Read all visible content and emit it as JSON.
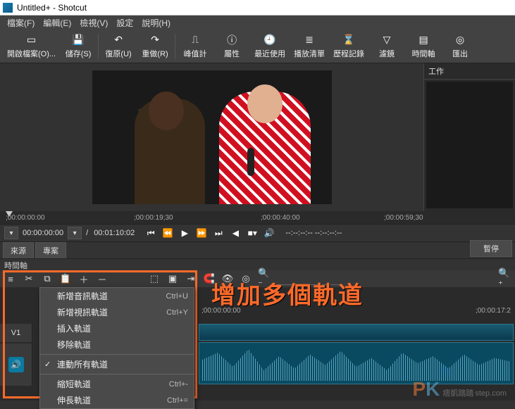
{
  "window": {
    "title": "Untitled+ - Shotcut"
  },
  "menu": {
    "file": "檔案(F)",
    "edit": "編輯(E)",
    "view": "檢視(V)",
    "settings": "設定",
    "help": "說明(H)"
  },
  "toolbar": {
    "open": "開啟檔案(O)...",
    "save": "儲存(S)",
    "undo": "復原(U)",
    "redo": "重做(R)",
    "peak": "峰值計",
    "properties": "屬性",
    "recent": "最近使用",
    "playlist": "播放清單",
    "history": "歷程記錄",
    "filters": "濾鏡",
    "timeline": "時間軸",
    "export": "匯出"
  },
  "side_panel": {
    "title": "工作"
  },
  "ruler": {
    "t0": ";00:00:00:00",
    "t1": ";00:00:19;30",
    "t2": ";00:00:40:00",
    "t3": ";00:00:59;30"
  },
  "transport": {
    "pos": "00:00:00:00",
    "sep": "/",
    "dur": "00:01:10:02",
    "inout": "--:--:--:--  --:--:--:--"
  },
  "tabs": {
    "source": "來源",
    "project": "專案",
    "pause": "暫停"
  },
  "timeline": {
    "label": "時間軸"
  },
  "context": {
    "add_audio": "新增音訊軌道",
    "add_audio_key": "Ctrl+U",
    "add_video": "新增視訊軌道",
    "add_video_key": "Ctrl+Y",
    "insert": "插入軌道",
    "remove": "移除軌道",
    "link_all": "連動所有軌道",
    "shorten": "縮短軌道",
    "shorten_key": "Ctrl+-",
    "lengthen": "伸長軌道",
    "lengthen_key": "Ctrl+="
  },
  "track": {
    "v1": "V1"
  },
  "ruler2": {
    "t0": ";00:00:00:00",
    "t1": ";00:00:17:2"
  },
  "annotation": {
    "text": "增加多個軌道"
  },
  "watermark": {
    "p": "P",
    "k": "K",
    "sub": "痞凱踏踏",
    "domain": "step.com"
  }
}
